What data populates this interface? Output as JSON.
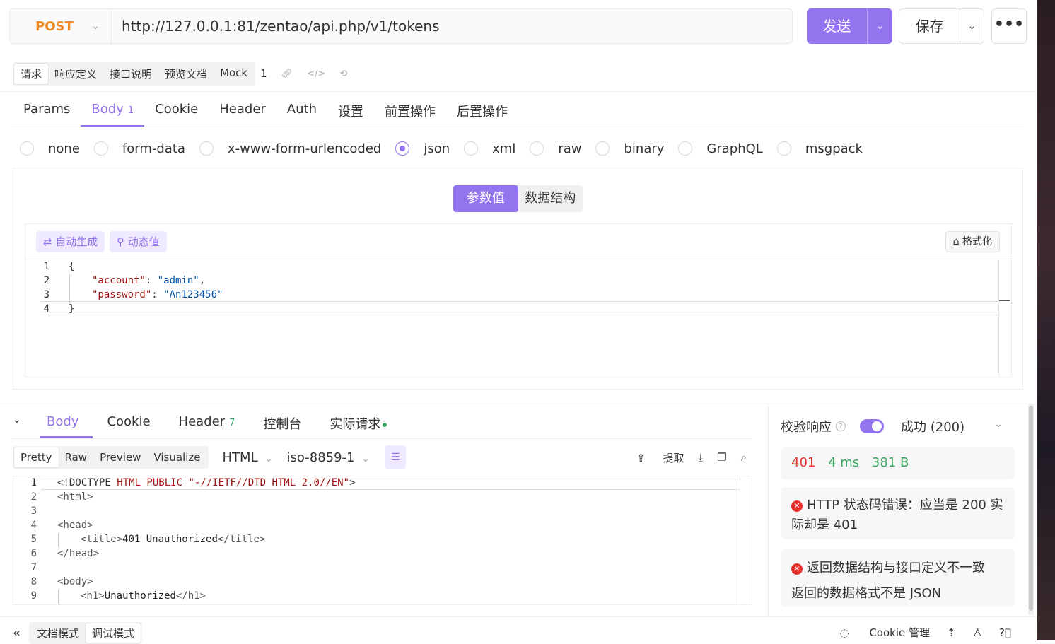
{
  "request": {
    "method": "POST",
    "url": "http://127.0.0.1:81/zentao/api.php/v1/tokens",
    "send_label": "发送",
    "save_label": "保存",
    "more_label": "•••"
  },
  "doc_tabs": {
    "items": [
      "请求",
      "响应定义",
      "接口说明",
      "预览文档",
      "Mock"
    ],
    "count": "1"
  },
  "req_tabs": {
    "items": [
      "Params",
      "Body",
      "Cookie",
      "Header",
      "Auth",
      "设置",
      "前置操作",
      "后置操作"
    ],
    "body_badge": "1"
  },
  "body_types": [
    "none",
    "form-data",
    "x-www-form-urlencoded",
    "json",
    "xml",
    "raw",
    "binary",
    "GraphQL",
    "msgpack"
  ],
  "body_type_selected": "json",
  "body_mode": {
    "values": "参数值",
    "schema": "数据结构"
  },
  "editor_tools": {
    "auto": "⇄ 自动生成",
    "dynamic": "⚲ 动态值",
    "format": "⌂ 格式化"
  },
  "request_body": {
    "line_numbers": [
      "1",
      "2",
      "3",
      "4"
    ],
    "open": "{",
    "key1": "\"account\"",
    "val1": "\"admin\"",
    "key2": "\"password\"",
    "val2": "\"An123456\"",
    "close": "}"
  },
  "response_tabs": {
    "items": [
      "Body",
      "Cookie",
      "Header",
      "控制台",
      "实际请求"
    ],
    "header_badge": "7"
  },
  "response_toolbar": {
    "views": [
      "Pretty",
      "Raw",
      "Preview",
      "Visualize"
    ],
    "format": "HTML",
    "charset": "iso-8859-1",
    "extract": "提取"
  },
  "response_body": {
    "line_numbers": [
      "1",
      "2",
      "3",
      "4",
      "5",
      "6",
      "7",
      "8",
      "9"
    ],
    "l1_open": "<!DOCTYPE",
    "l1_attrs": " HTML PUBLIC ",
    "l1_str": "\"-//IETF//DTD HTML 2.0//EN\"",
    "l1_close": ">",
    "l2": "<html>",
    "l4": "<head>",
    "l5_open": "<title>",
    "l5_text": "401 Unauthorized",
    "l5_close": "</title>",
    "l6": "</head>",
    "l8": "<body>",
    "l9_open": "<h1>",
    "l9_text": "Unauthorized",
    "l9_close": "</h1>"
  },
  "validation": {
    "title": "校验响应",
    "status": "成功 (200)",
    "code": "401",
    "time": "4 ms",
    "size": "381 B",
    "error1": "HTTP 状态码错误：应当是 200 实际却是 401",
    "error2_title": "返回数据结构与接口定义不一致",
    "error2_detail": "返回的数据格式不是 JSON"
  },
  "bottom_bar": {
    "modes": [
      "文档模式",
      "调试模式"
    ],
    "cookie": "Cookie 管理"
  },
  "colors": {
    "accent": "#9373ee",
    "method": "#f08a24",
    "error": "#e5322d",
    "success": "#3aa55e"
  }
}
